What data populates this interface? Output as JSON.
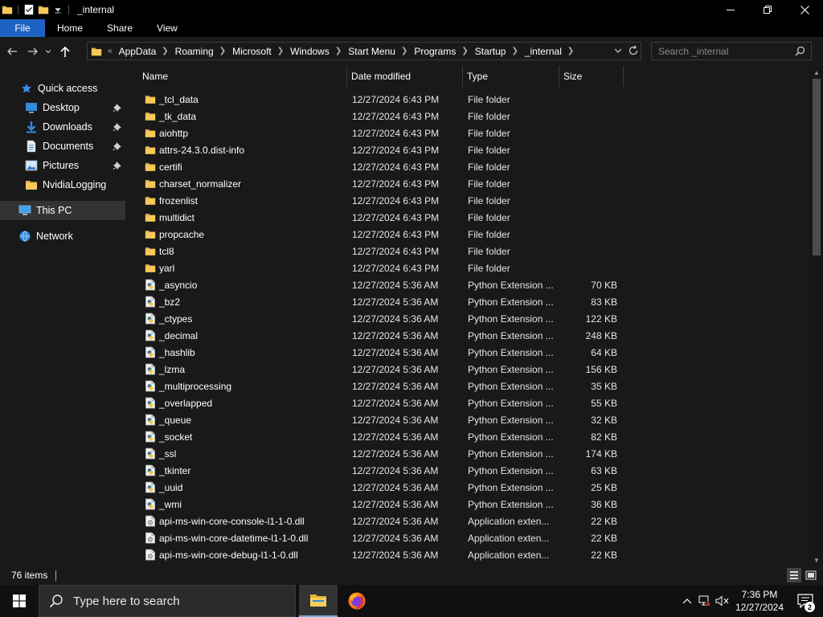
{
  "window": {
    "title": "_internal"
  },
  "ribbon": {
    "tabs": [
      "File",
      "Home",
      "Share",
      "View"
    ]
  },
  "address": {
    "overflow": "«",
    "crumbs": [
      "AppData",
      "Roaming",
      "Microsoft",
      "Windows",
      "Start Menu",
      "Programs",
      "Startup",
      "_internal"
    ]
  },
  "search": {
    "placeholder": "Search _internal"
  },
  "sidebar": {
    "items": [
      {
        "label": "Quick access",
        "icon": "star-icon"
      },
      {
        "label": "Desktop",
        "icon": "desktop-icon",
        "pinned": true
      },
      {
        "label": "Downloads",
        "icon": "download-icon",
        "pinned": true
      },
      {
        "label": "Documents",
        "icon": "document-icon",
        "pinned": true
      },
      {
        "label": "Pictures",
        "icon": "picture-icon",
        "pinned": true
      },
      {
        "label": "NvidiaLogging",
        "icon": "folder-icon"
      },
      {
        "label": "This PC",
        "icon": "computer-icon",
        "selected": true
      },
      {
        "label": "Network",
        "icon": "network-icon"
      }
    ]
  },
  "columns": {
    "name": "Name",
    "date": "Date modified",
    "type": "Type",
    "size": "Size"
  },
  "files": [
    {
      "name": "_tcl_data",
      "date": "12/27/2024 6:43 PM",
      "type": "File folder",
      "size": "",
      "kind": "folder"
    },
    {
      "name": "_tk_data",
      "date": "12/27/2024 6:43 PM",
      "type": "File folder",
      "size": "",
      "kind": "folder"
    },
    {
      "name": "aiohttp",
      "date": "12/27/2024 6:43 PM",
      "type": "File folder",
      "size": "",
      "kind": "folder"
    },
    {
      "name": "attrs-24.3.0.dist-info",
      "date": "12/27/2024 6:43 PM",
      "type": "File folder",
      "size": "",
      "kind": "folder"
    },
    {
      "name": "certifi",
      "date": "12/27/2024 6:43 PM",
      "type": "File folder",
      "size": "",
      "kind": "folder"
    },
    {
      "name": "charset_normalizer",
      "date": "12/27/2024 6:43 PM",
      "type": "File folder",
      "size": "",
      "kind": "folder"
    },
    {
      "name": "frozenlist",
      "date": "12/27/2024 6:43 PM",
      "type": "File folder",
      "size": "",
      "kind": "folder"
    },
    {
      "name": "multidict",
      "date": "12/27/2024 6:43 PM",
      "type": "File folder",
      "size": "",
      "kind": "folder"
    },
    {
      "name": "propcache",
      "date": "12/27/2024 6:43 PM",
      "type": "File folder",
      "size": "",
      "kind": "folder"
    },
    {
      "name": "tcl8",
      "date": "12/27/2024 6:43 PM",
      "type": "File folder",
      "size": "",
      "kind": "folder"
    },
    {
      "name": "yarl",
      "date": "12/27/2024 6:43 PM",
      "type": "File folder",
      "size": "",
      "kind": "folder"
    },
    {
      "name": "_asyncio",
      "date": "12/27/2024 5:36 AM",
      "type": "Python Extension ...",
      "size": "70 KB",
      "kind": "pyd"
    },
    {
      "name": "_bz2",
      "date": "12/27/2024 5:36 AM",
      "type": "Python Extension ...",
      "size": "83 KB",
      "kind": "pyd"
    },
    {
      "name": "_ctypes",
      "date": "12/27/2024 5:36 AM",
      "type": "Python Extension ...",
      "size": "122 KB",
      "kind": "pyd"
    },
    {
      "name": "_decimal",
      "date": "12/27/2024 5:36 AM",
      "type": "Python Extension ...",
      "size": "248 KB",
      "kind": "pyd"
    },
    {
      "name": "_hashlib",
      "date": "12/27/2024 5:36 AM",
      "type": "Python Extension ...",
      "size": "64 KB",
      "kind": "pyd"
    },
    {
      "name": "_lzma",
      "date": "12/27/2024 5:36 AM",
      "type": "Python Extension ...",
      "size": "156 KB",
      "kind": "pyd"
    },
    {
      "name": "_multiprocessing",
      "date": "12/27/2024 5:36 AM",
      "type": "Python Extension ...",
      "size": "35 KB",
      "kind": "pyd"
    },
    {
      "name": "_overlapped",
      "date": "12/27/2024 5:36 AM",
      "type": "Python Extension ...",
      "size": "55 KB",
      "kind": "pyd"
    },
    {
      "name": "_queue",
      "date": "12/27/2024 5:36 AM",
      "type": "Python Extension ...",
      "size": "32 KB",
      "kind": "pyd"
    },
    {
      "name": "_socket",
      "date": "12/27/2024 5:36 AM",
      "type": "Python Extension ...",
      "size": "82 KB",
      "kind": "pyd"
    },
    {
      "name": "_ssl",
      "date": "12/27/2024 5:36 AM",
      "type": "Python Extension ...",
      "size": "174 KB",
      "kind": "pyd"
    },
    {
      "name": "_tkinter",
      "date": "12/27/2024 5:36 AM",
      "type": "Python Extension ...",
      "size": "63 KB",
      "kind": "pyd"
    },
    {
      "name": "_uuid",
      "date": "12/27/2024 5:36 AM",
      "type": "Python Extension ...",
      "size": "25 KB",
      "kind": "pyd"
    },
    {
      "name": "_wmi",
      "date": "12/27/2024 5:36 AM",
      "type": "Python Extension ...",
      "size": "36 KB",
      "kind": "pyd"
    },
    {
      "name": "api-ms-win-core-console-l1-1-0.dll",
      "date": "12/27/2024 5:36 AM",
      "type": "Application exten...",
      "size": "22 KB",
      "kind": "dll"
    },
    {
      "name": "api-ms-win-core-datetime-l1-1-0.dll",
      "date": "12/27/2024 5:36 AM",
      "type": "Application exten...",
      "size": "22 KB",
      "kind": "dll"
    },
    {
      "name": "api-ms-win-core-debug-l1-1-0.dll",
      "date": "12/27/2024 5:36 AM",
      "type": "Application exten...",
      "size": "22 KB",
      "kind": "dll"
    }
  ],
  "status": {
    "item_count": "76 items"
  },
  "taskbar": {
    "search_placeholder": "Type here to search",
    "time": "7:36 PM",
    "date": "12/27/2024",
    "notification_count": "2"
  },
  "colors": {
    "accent": "#1f63c2",
    "folder": "#f6c959",
    "background": "#191919"
  }
}
